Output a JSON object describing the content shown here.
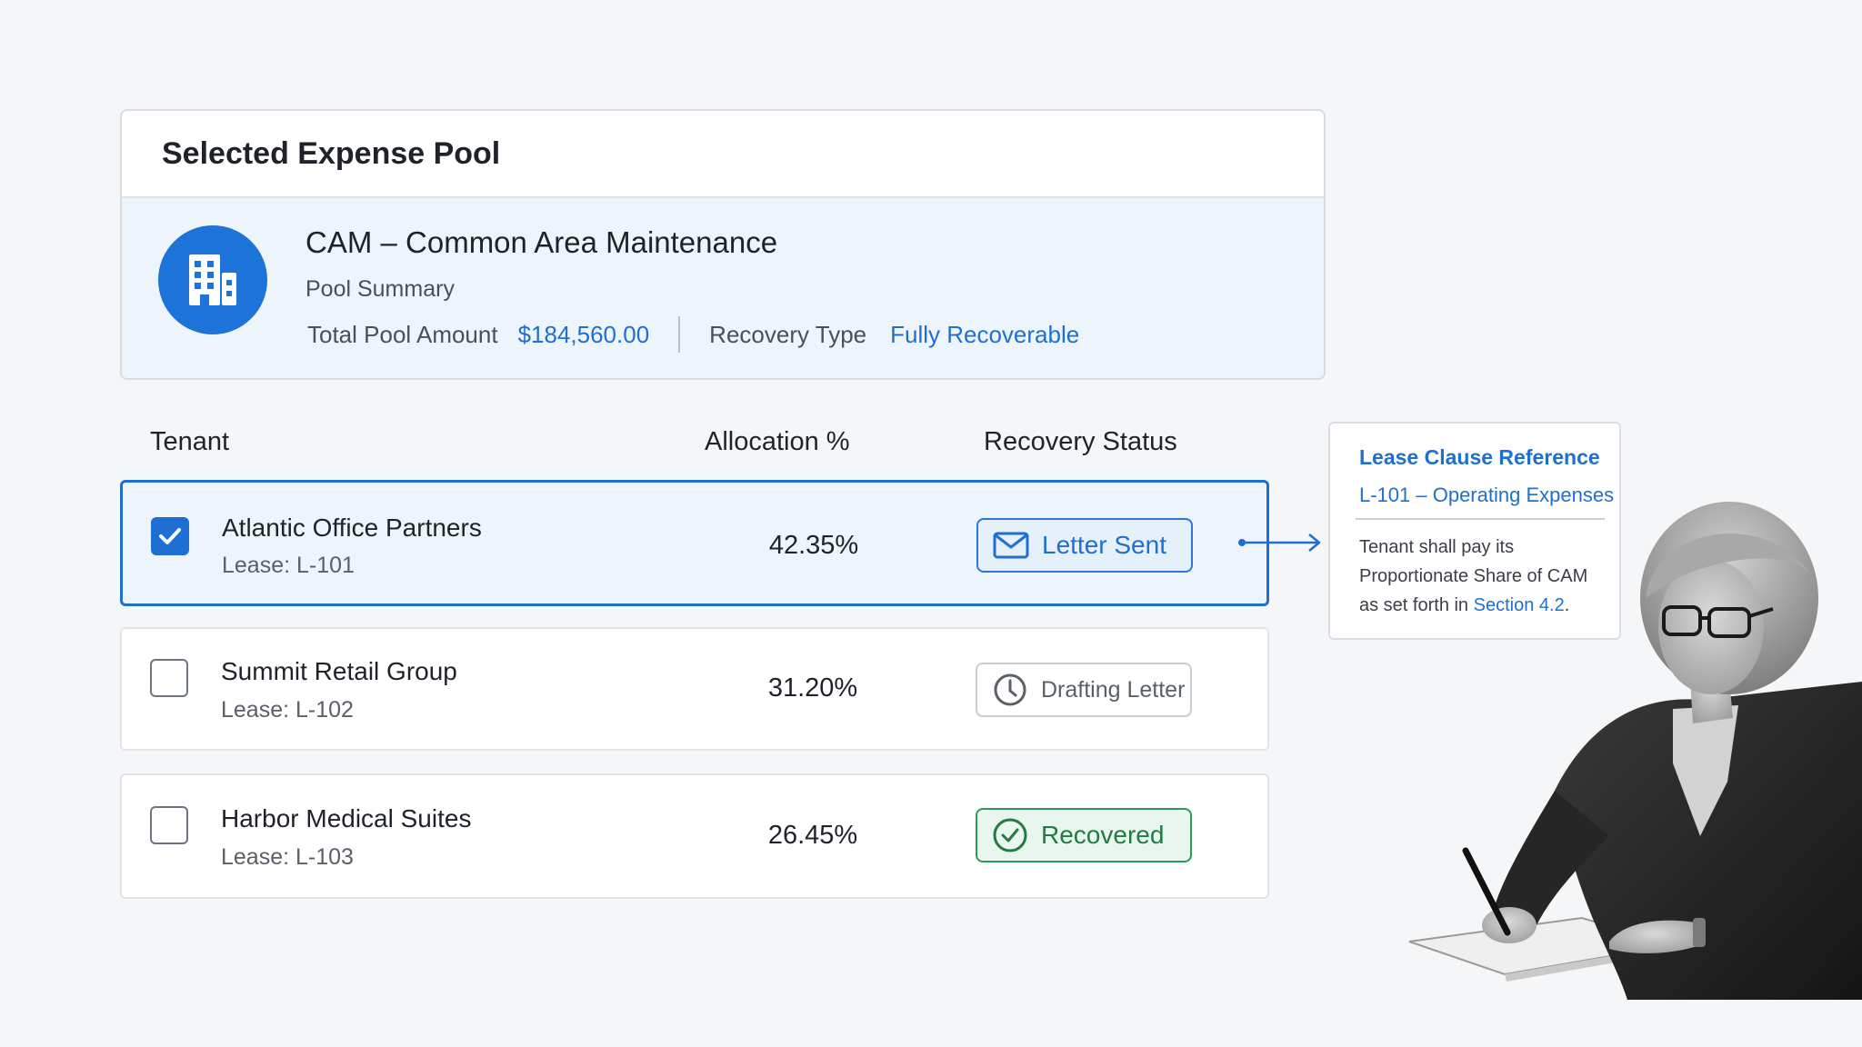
{
  "pool": {
    "header_title": "Selected Expense Pool",
    "name": "CAM – Common Area Maintenance",
    "summary_label": "Pool Summary",
    "total_label": "Total Pool Amount",
    "total_value": "$184,560.00",
    "recovery_type_label": "Recovery Type",
    "recovery_type_value": "Fully Recoverable",
    "icon": "building-icon"
  },
  "table": {
    "headers": {
      "tenant": "Tenant",
      "allocation": "Allocation %",
      "status": "Recovery Status"
    },
    "rows": [
      {
        "tenant": "Atlantic Office Partners",
        "lease": "Lease: L-101",
        "allocation": "42.35%",
        "status": "Letter Sent",
        "status_icon": "envelope-icon",
        "checked": true
      },
      {
        "tenant": "Summit Retail Group",
        "lease": "Lease: L-102",
        "allocation": "31.20%",
        "status": "Drafting Letter",
        "status_icon": "clock-icon",
        "checked": false
      },
      {
        "tenant": "Harbor Medical Suites",
        "lease": "Lease: L-103",
        "allocation": "26.45%",
        "status": "Recovered",
        "status_icon": "check-circle-icon",
        "checked": false
      }
    ]
  },
  "clause": {
    "title": "Lease Clause Reference",
    "subtitle": "L-101 – Operating Expenses",
    "text_line1": "Tenant shall pay its",
    "text_line2": "Proportionate Share of CAM",
    "text_line3_prefix": "as set forth in ",
    "text_line3_link": "Section 4.2",
    "text_line3_suffix": "."
  },
  "colors": {
    "accent": "#1d6fd4",
    "success": "#2f9a58",
    "selected_row_bg": "#eef4fb"
  }
}
